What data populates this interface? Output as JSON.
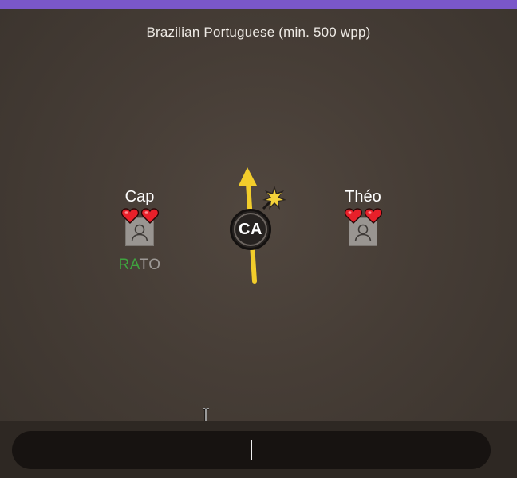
{
  "game": {
    "title": "Brazilian Portuguese (min. 500 wpp)"
  },
  "players": [
    {
      "name": "Cap",
      "lives": 2,
      "word_typed": "RA",
      "word_rest": "TO"
    },
    {
      "name": "Théo",
      "lives": 2,
      "word_typed": "",
      "word_rest": ""
    }
  ],
  "bomb": {
    "syllable": "CA"
  },
  "chat_input": {
    "value": "",
    "placeholder": ""
  },
  "colors": {
    "accent_bar": "#7a57c9",
    "arrow": "#f2cd2b",
    "typed_letters": "#3fa33f",
    "heart": "#e8202a"
  },
  "icons": {
    "heart": "heart-icon",
    "avatar": "person-placeholder-icon",
    "spark": "spark-icon"
  }
}
